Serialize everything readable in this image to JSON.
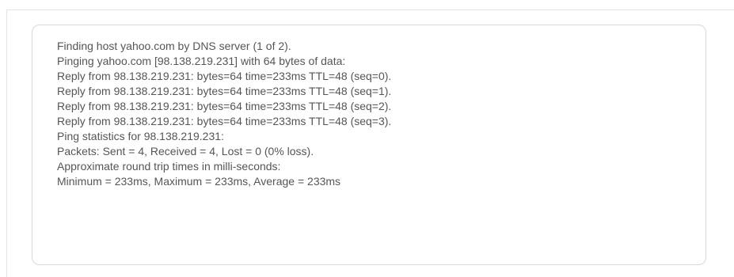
{
  "ping_output": {
    "lines": [
      "Finding host yahoo.com by DNS server (1 of 2).",
      "Pinging yahoo.com [98.138.219.231] with 64 bytes of data:",
      "Reply from 98.138.219.231: bytes=64 time=233ms TTL=48 (seq=0).",
      "Reply from 98.138.219.231: bytes=64 time=233ms TTL=48 (seq=1).",
      "Reply from 98.138.219.231: bytes=64 time=233ms TTL=48 (seq=2).",
      "Reply from 98.138.219.231: bytes=64 time=233ms TTL=48 (seq=3).",
      "Ping statistics for 98.138.219.231:",
      "Packets: Sent = 4, Received = 4, Lost = 0 (0% loss).",
      "Approximate round trip times in milli-seconds:",
      "Minimum = 233ms, Maximum = 233ms, Average = 233ms"
    ]
  }
}
